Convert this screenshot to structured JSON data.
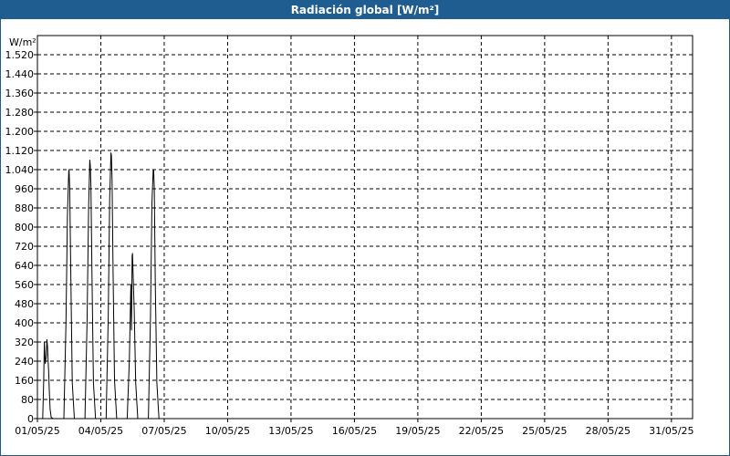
{
  "window": {
    "title": "Radiación global [W/m²]"
  },
  "chart_data": {
    "type": "line",
    "title": "Radiación global [W/m²]",
    "ylabel": "W/m²",
    "xlabel": "",
    "ylim": [
      0,
      1600
    ],
    "xlim": [
      1,
      32
    ],
    "grid": true,
    "yticks": [
      0,
      80,
      160,
      240,
      320,
      400,
      480,
      560,
      640,
      720,
      800,
      880,
      960,
      1040,
      1120,
      1200,
      1280,
      1360,
      1440,
      1520
    ],
    "ytick_labels": [
      "0",
      "80",
      "160",
      "240",
      "320",
      "400",
      "480",
      "560",
      "640",
      "720",
      "800",
      "880",
      "960",
      "1.040",
      "1.120",
      "1.200",
      "1.280",
      "1.360",
      "1.440",
      "1.520"
    ],
    "xticks": [
      1,
      4,
      7,
      10,
      13,
      16,
      19,
      22,
      25,
      28,
      31
    ],
    "xtick_labels": [
      "01/05/25",
      "04/05/25",
      "07/05/25",
      "10/05/25",
      "13/05/25",
      "16/05/25",
      "19/05/25",
      "22/05/25",
      "25/05/25",
      "28/05/25",
      "31/05/25"
    ],
    "series": [
      {
        "color": "#000000",
        "x": [
          1.0,
          1.25,
          1.3,
          1.33,
          1.37,
          1.42,
          1.45,
          1.48,
          1.5,
          1.53,
          1.56,
          1.6,
          1.65,
          1.75,
          2.0,
          2.25,
          2.35,
          2.42,
          2.48,
          2.5,
          2.53,
          2.58,
          2.65,
          2.75,
          3.0,
          3.25,
          3.35,
          3.42,
          3.48,
          3.5,
          3.53,
          3.58,
          3.65,
          3.75,
          4.0,
          4.25,
          4.35,
          4.42,
          4.48,
          4.5,
          4.53,
          4.58,
          4.65,
          4.75,
          5.0,
          5.25,
          5.35,
          5.42,
          5.45,
          5.48,
          5.5,
          5.53,
          5.58,
          5.65,
          5.75,
          6.0,
          6.25,
          6.35,
          6.42,
          6.48,
          6.5,
          6.53,
          6.58,
          6.65,
          6.75,
          7.0,
          7.1
        ],
        "y": [
          0,
          0,
          160,
          320,
          230,
          260,
          330,
          300,
          250,
          200,
          120,
          40,
          5,
          0,
          0,
          0,
          400,
          850,
          1030,
          1040,
          960,
          600,
          150,
          0,
          0,
          0,
          400,
          880,
          1080,
          1060,
          980,
          600,
          150,
          0,
          0,
          0,
          420,
          920,
          1110,
          1100,
          1000,
          620,
          160,
          0,
          0,
          0,
          250,
          560,
          370,
          680,
          690,
          600,
          450,
          150,
          0,
          0,
          0,
          420,
          900,
          1040,
          1040,
          960,
          560,
          150,
          0,
          0,
          0
        ]
      }
    ]
  }
}
